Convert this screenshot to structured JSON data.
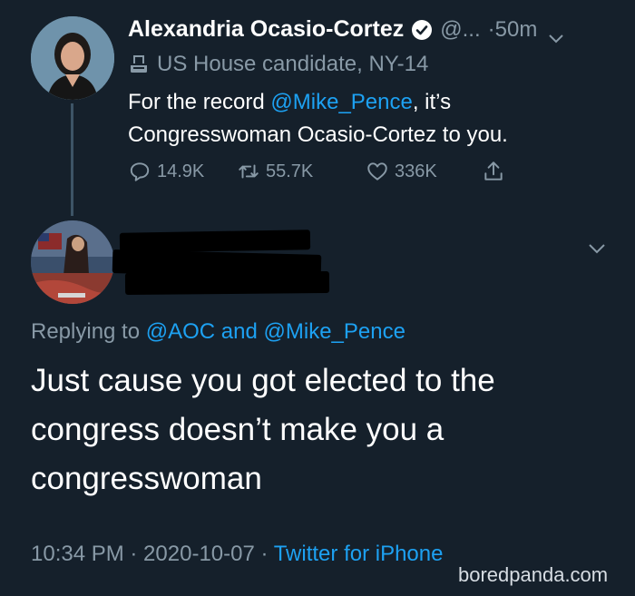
{
  "tweet1": {
    "author_name": "Alexandria Ocasio-Cortez",
    "handle": "@...",
    "time": "·50m",
    "label": "US House candidate, NY-14",
    "text_prefix": "For the record ",
    "mention": "@Mike_Pence",
    "text_suffix": ", it’s Congresswoman Ocasio-Cortez to you.",
    "replies": "14.9K",
    "retweets": "55.7K",
    "likes": "336K"
  },
  "tweet2": {
    "replying_prefix": "Replying to ",
    "replying_mention1": "@AOC",
    "replying_and": " and ",
    "replying_mention2": "@Mike_Pence",
    "text": "Just cause you got elected to the congress doesn’t make you a congresswoman",
    "timestamp": "10:34 PM · 2020-10-07 · ",
    "source": "Twitter for iPhone"
  },
  "watermark": "boredpanda.com",
  "colors": {
    "background": "#15202b",
    "link": "#1da1f2",
    "muted": "#8899a6",
    "thread_line": "#3d5466"
  }
}
